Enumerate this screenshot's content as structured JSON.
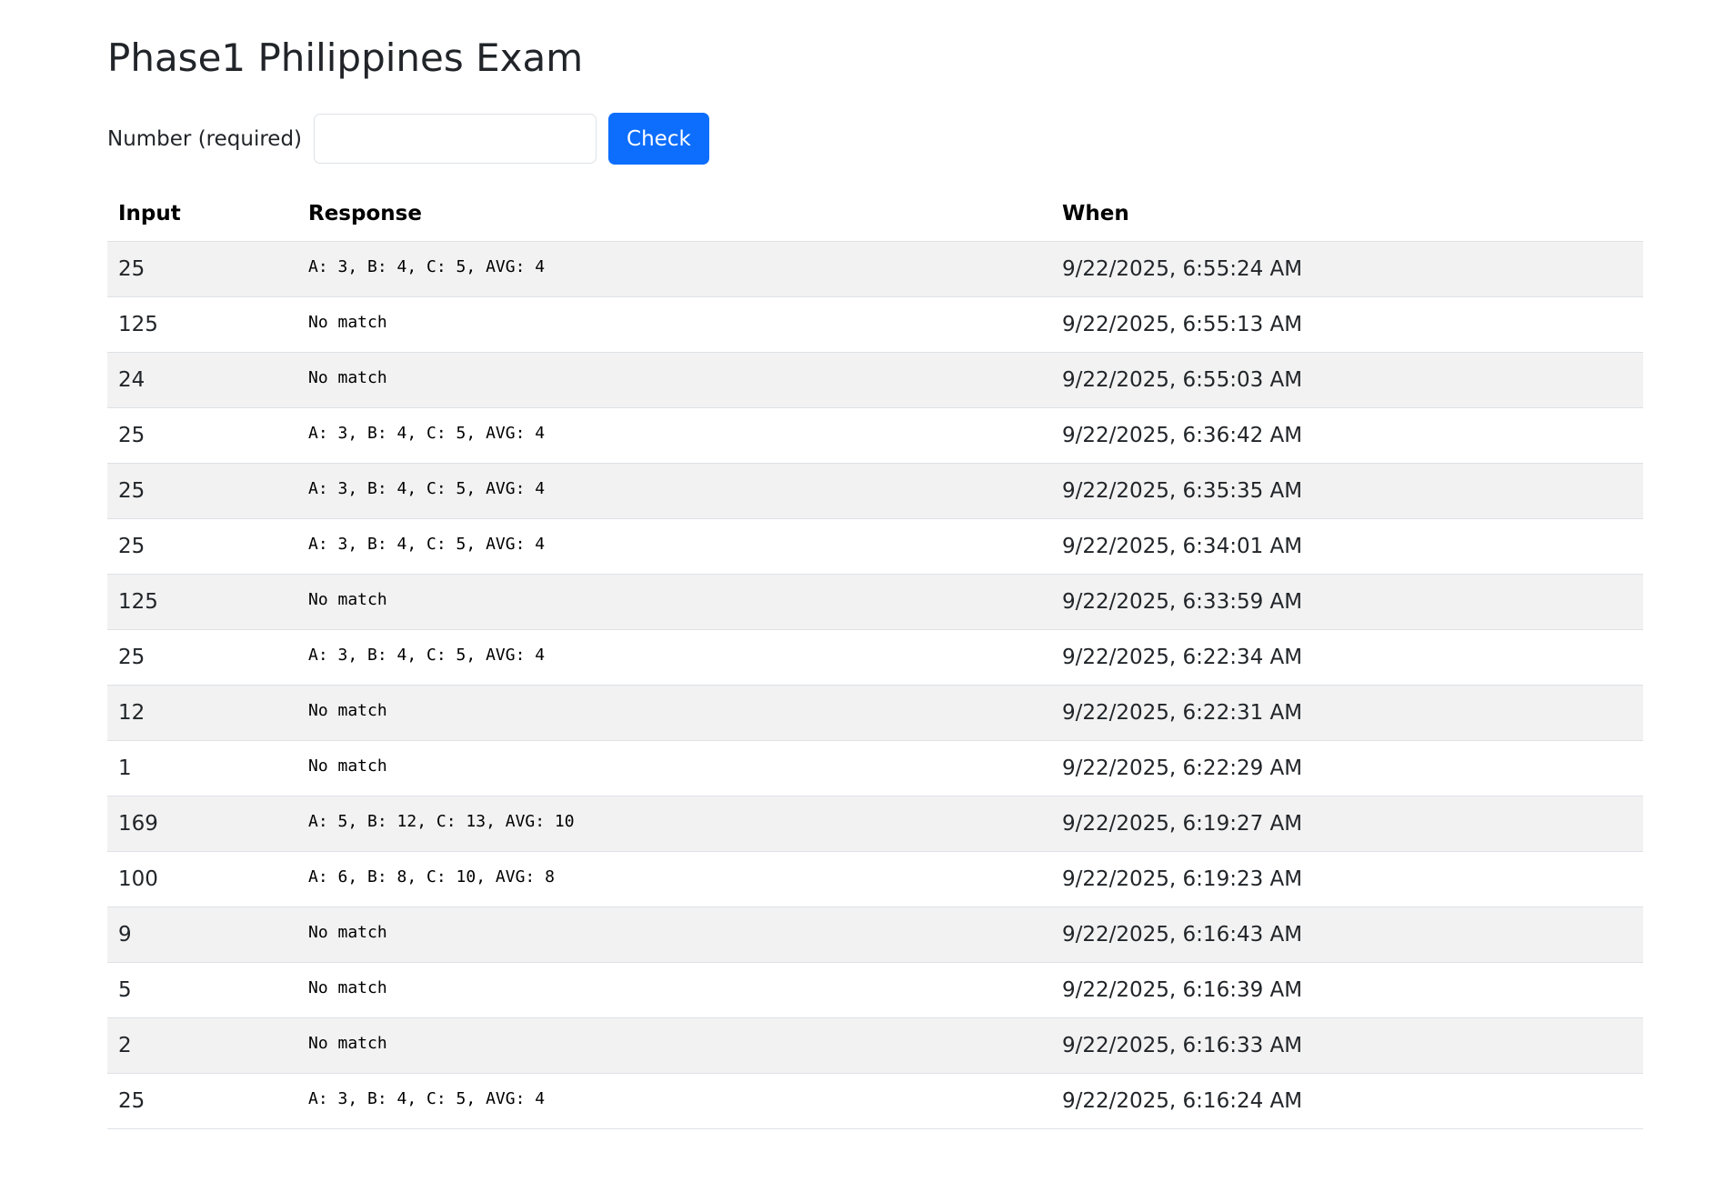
{
  "header": {
    "title": "Phase1 Philippines Exam"
  },
  "form": {
    "label": "Number (required)",
    "input_value": "",
    "input_placeholder": "",
    "button_label": "Check"
  },
  "table": {
    "columns": [
      "Input",
      "Response",
      "When"
    ],
    "rows": [
      {
        "input": "25",
        "response": "A: 3, B: 4, C: 5, AVG: 4",
        "when": "9/22/2025, 6:55:24 AM"
      },
      {
        "input": "125",
        "response": "No match",
        "when": "9/22/2025, 6:55:13 AM"
      },
      {
        "input": "24",
        "response": "No match",
        "when": "9/22/2025, 6:55:03 AM"
      },
      {
        "input": "25",
        "response": "A: 3, B: 4, C: 5, AVG: 4",
        "when": "9/22/2025, 6:36:42 AM"
      },
      {
        "input": "25",
        "response": "A: 3, B: 4, C: 5, AVG: 4",
        "when": "9/22/2025, 6:35:35 AM"
      },
      {
        "input": "25",
        "response": "A: 3, B: 4, C: 5, AVG: 4",
        "when": "9/22/2025, 6:34:01 AM"
      },
      {
        "input": "125",
        "response": "No match",
        "when": "9/22/2025, 6:33:59 AM"
      },
      {
        "input": "25",
        "response": "A: 3, B: 4, C: 5, AVG: 4",
        "when": "9/22/2025, 6:22:34 AM"
      },
      {
        "input": "12",
        "response": "No match",
        "when": "9/22/2025, 6:22:31 AM"
      },
      {
        "input": "1",
        "response": "No match",
        "when": "9/22/2025, 6:22:29 AM"
      },
      {
        "input": "169",
        "response": "A: 5, B: 12, C: 13, AVG: 10",
        "when": "9/22/2025, 6:19:27 AM"
      },
      {
        "input": "100",
        "response": "A: 6, B: 8, C: 10, AVG: 8",
        "when": "9/22/2025, 6:19:23 AM"
      },
      {
        "input": "9",
        "response": "No match",
        "when": "9/22/2025, 6:16:43 AM"
      },
      {
        "input": "5",
        "response": "No match",
        "when": "9/22/2025, 6:16:39 AM"
      },
      {
        "input": "2",
        "response": "No match",
        "when": "9/22/2025, 6:16:33 AM"
      },
      {
        "input": "25",
        "response": "A: 3, B: 4, C: 5, AVG: 4",
        "when": "9/22/2025, 6:16:24 AM"
      }
    ]
  },
  "colors": {
    "primary_button": "#0d6efd",
    "stripe_row": "#f2f2f2",
    "border": "#dee2e6"
  }
}
